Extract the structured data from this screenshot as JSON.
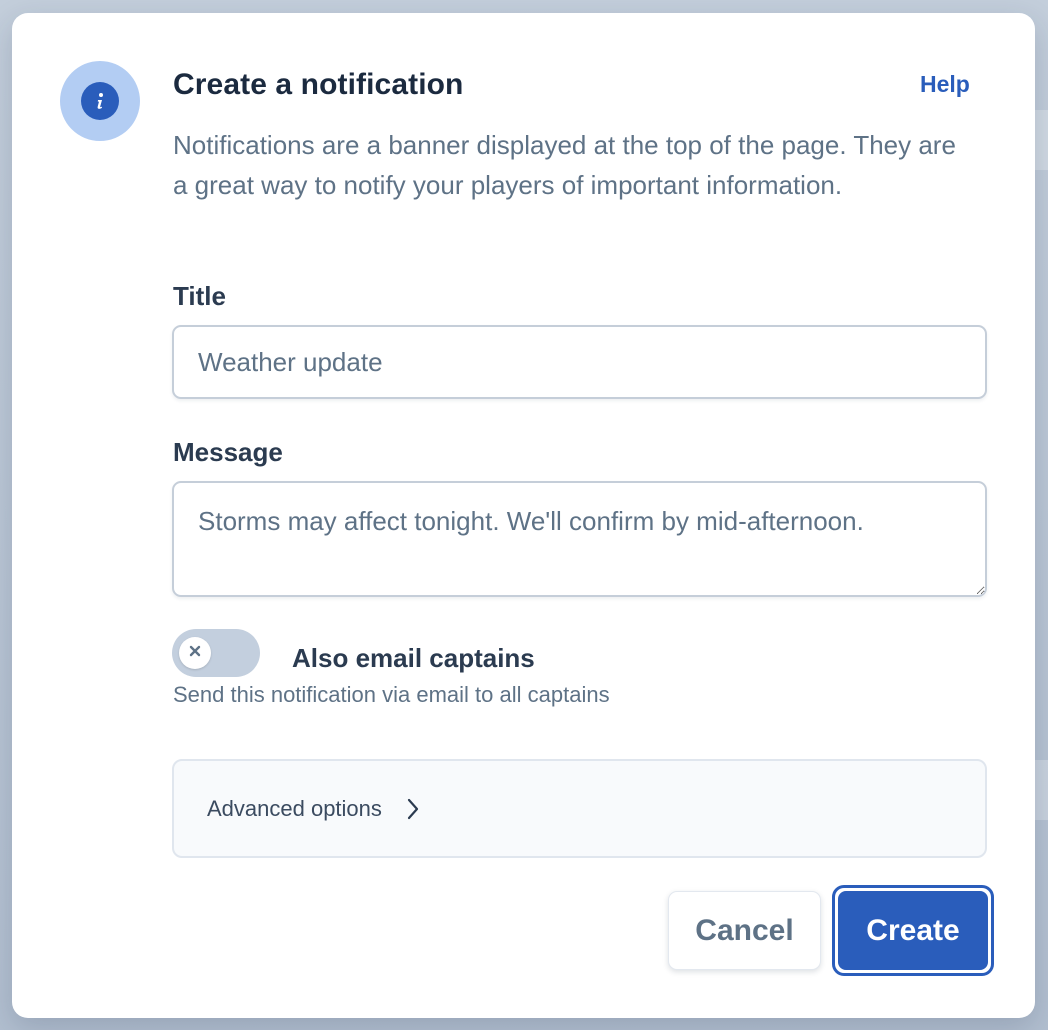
{
  "dialog": {
    "title": "Create a notification",
    "help_label": "Help",
    "description": "Notifications are a banner displayed at the top of the page. They are a great way to notify your players of important information."
  },
  "form": {
    "title_label": "Title",
    "title_value": "Weather update",
    "message_label": "Message",
    "message_value": "Storms may affect tonight. We'll confirm by mid-afternoon.",
    "email_toggle": {
      "label": "Also email captains",
      "help": "Send this notification via email to all captains",
      "enabled": false
    },
    "advanced_label": "Advanced options"
  },
  "actions": {
    "cancel_label": "Cancel",
    "create_label": "Create"
  },
  "icons": {
    "info": "info-icon",
    "toggle_off": "x-icon",
    "advanced": "chevron-right-icon"
  },
  "colors": {
    "accent": "#2a5dbb",
    "accent_light": "#b3cdf3",
    "heading": "#1b2a3f",
    "muted": "#5e7286"
  }
}
